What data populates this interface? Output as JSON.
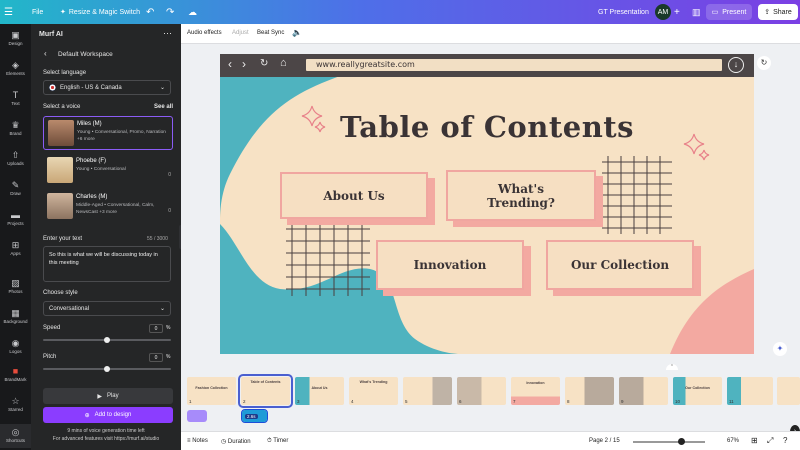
{
  "topbar": {
    "menu_icon": "hamburger-menu-icon",
    "file": "File",
    "magic": "Resize & Magic Switch",
    "title": "GT Presentation",
    "avatar": "AM",
    "present": "Present",
    "share": "Share"
  },
  "rail": {
    "items": [
      "Design",
      "Elements",
      "Text",
      "Brand",
      "Uploads",
      "Draw",
      "Projects",
      "Apps",
      "Photos",
      "Background",
      "Logos",
      "BrandMark",
      "Starred",
      "Shortcuts"
    ]
  },
  "panel": {
    "app_name": "Murf AI",
    "workspace": "Default Workspace",
    "language_label": "Select language",
    "language_value": "English - US & Canada",
    "voice_label": "Select a voice",
    "see_all": "See all",
    "voices": [
      {
        "name": "Miles (M)",
        "desc": "Young  •  Conversational, Promo, Narration +6 more",
        "count": ""
      },
      {
        "name": "Phoebe (F)",
        "desc": "Young  •  Conversational",
        "count": "0"
      },
      {
        "name": "Charles (M)",
        "desc": "Middle-Aged  •  Conversational, Calm, NewsCast +3 more",
        "count": "0"
      }
    ],
    "text_label": "Enter your text",
    "char_count": "55 / 3000",
    "text_value": "So this is what we will be discussing today in this meeting",
    "style_label": "Choose style",
    "style_value": "Conversational",
    "speed_label": "Speed",
    "speed_value": "0",
    "pitch_label": "Pitch",
    "pitch_value": "0",
    "percent": "%",
    "play": "Play",
    "add_to_design": "Add to design",
    "minutes_left": "9 mins of voice generation time left",
    "advanced": "For advanced features visit https://murf.ai/studio"
  },
  "context_bar": {
    "audio_effects": "Audio effects",
    "adjust": "Adjust",
    "beat_sync": "Beat Sync"
  },
  "slide": {
    "url": "www.reallygreatsite.com",
    "title": "Table of Contents",
    "items": [
      "About Us",
      "What's Trending?",
      "Innovation",
      "Our Collection"
    ]
  },
  "thumbnails": [
    {
      "num": "1",
      "label": "Fashion Collection"
    },
    {
      "num": "2",
      "label": "Table of Contents"
    },
    {
      "num": "3",
      "label": "About Us"
    },
    {
      "num": "4",
      "label": "What's Trending"
    },
    {
      "num": "5",
      "label": ""
    },
    {
      "num": "6",
      "label": ""
    },
    {
      "num": "7",
      "label": "Innovation"
    },
    {
      "num": "8",
      "label": ""
    },
    {
      "num": "9",
      "label": ""
    },
    {
      "num": "10",
      "label": "Our Collection"
    },
    {
      "num": "11",
      "label": ""
    }
  ],
  "audio_clip": "2.6s",
  "bottombar": {
    "notes": "Notes",
    "duration": "Duration",
    "timer": "Timer",
    "page": "Page 2 / 15",
    "zoom": "67%"
  },
  "colors": {
    "accent": "#8b3dff",
    "slide_bg": "#f7e2c5",
    "teal": "#4fb3bf",
    "coral": "#f3a9a1",
    "dark": "#3a3335"
  },
  "zoom_level": 0.67
}
